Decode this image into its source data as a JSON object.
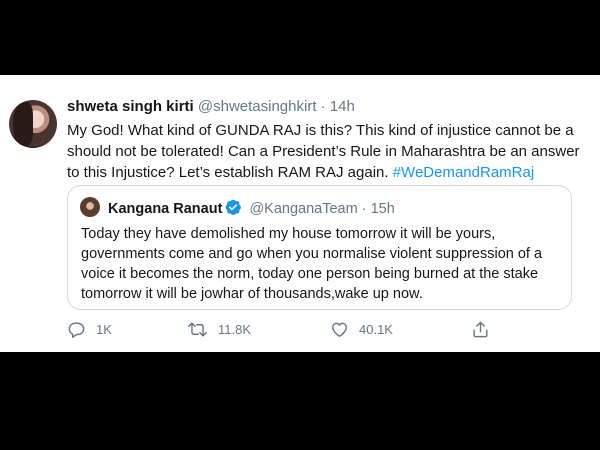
{
  "tweet": {
    "display_name": "shweta singh kirti",
    "handle": "@shwetasinghkirt",
    "separator": "·",
    "time": "14h",
    "lines": [
      "My God! What kind of GUNDA RAJ is this? This kind of injustice cannot be a",
      "should not be tolerated! Can a President’s Rule in Maharashtra be an answer",
      "to this Injustice? Let’s establish RAM RAJ again. "
    ],
    "hashtag": "#WeDemandRamRaj"
  },
  "quoted": {
    "display_name": "Kangana Ranaut",
    "handle": "@KanganaTeam",
    "separator": "·",
    "time": "15h",
    "lines": [
      "Today they have demolished my house tomorrow it will be yours,",
      "governments come and go when you normalise violent suppression of a",
      "voice it becomes the norm, today one person being burned at the stake",
      "tomorrow it will be jowhar of thousands,wake up now."
    ]
  },
  "actions": {
    "reply_count": "1K",
    "retweet_count": "11.8K",
    "like_count": "40.1K"
  },
  "icons": {
    "reply": "reply-icon",
    "retweet": "retweet-icon",
    "like": "like-icon",
    "share": "share-icon",
    "verified": "verified-badge-icon"
  },
  "colors": {
    "accent": "#1b95e0",
    "text": "#14171a",
    "muted": "#657786",
    "border": "#cfd9de",
    "letterbox": "#000000"
  }
}
